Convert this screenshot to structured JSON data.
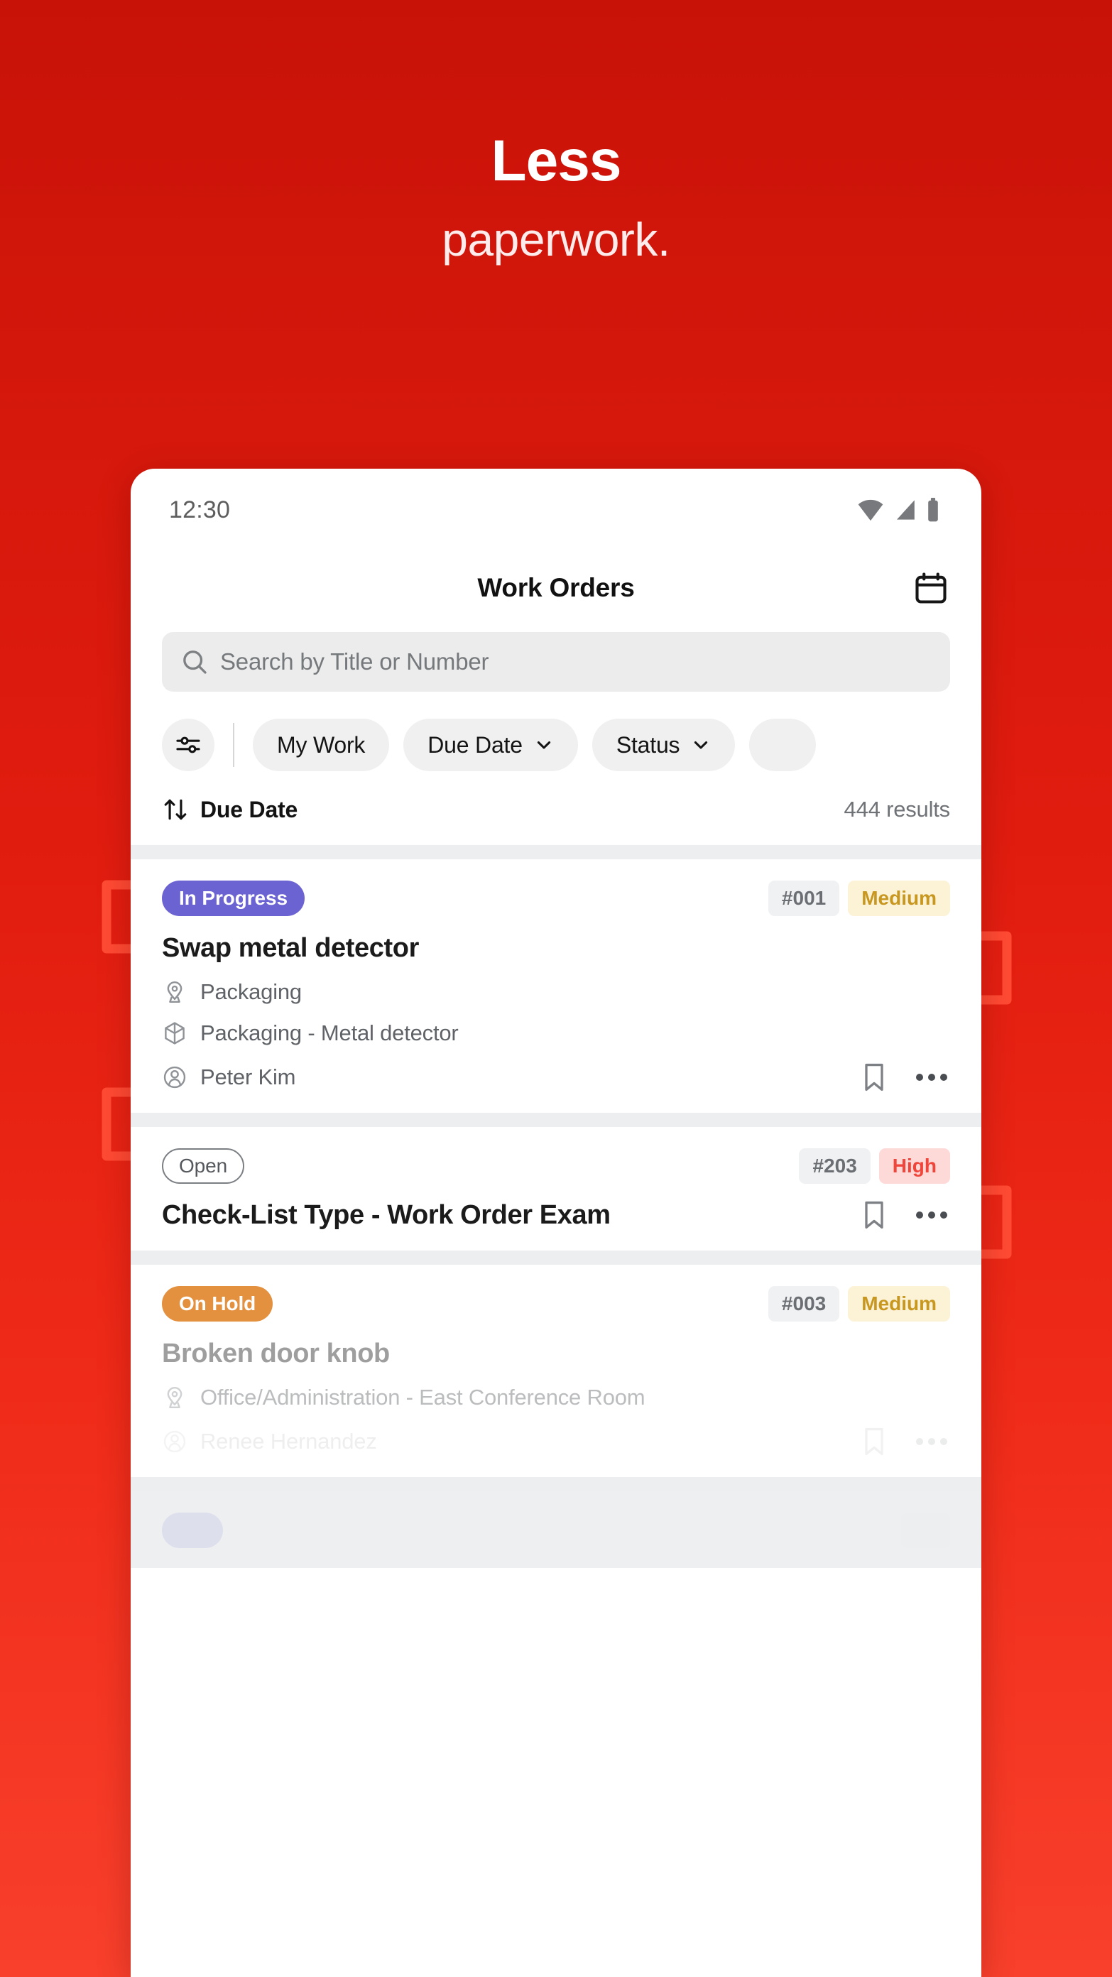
{
  "promo": {
    "headline": "Less",
    "subhead": "paperwork.",
    "background_start": "#c81208",
    "background_end": "#f8402c"
  },
  "statusbar": {
    "time": "12:30",
    "icons": [
      "wifi-icon",
      "cellular-signal-icon",
      "battery-icon"
    ]
  },
  "appbar": {
    "title": "Work Orders",
    "action_icon": "calendar-icon"
  },
  "search": {
    "placeholder": "Search by Title or Number",
    "icon": "search-icon"
  },
  "filters": {
    "tune_icon": "filter-sliders-icon",
    "chips": [
      {
        "label": "My Work",
        "has_chevron": false
      },
      {
        "label": "Due Date",
        "has_chevron": true
      },
      {
        "label": "Status",
        "has_chevron": true
      },
      {
        "label": "",
        "has_chevron": false
      }
    ]
  },
  "sort": {
    "icon": "sort-arrows-icon",
    "label": "Due Date",
    "results": "444 results"
  },
  "work_orders": [
    {
      "status": "In Progress",
      "status_bg": "#6c63d2",
      "status_style": "solid",
      "number": "#001",
      "priority": "Medium",
      "priority_bg": "#fcf2d6",
      "priority_color": "#c8971f",
      "title": "Swap metal detector",
      "location": "Packaging",
      "asset": "Packaging - Metal detector",
      "assignee": "Peter Kim",
      "bookmark_icon": "bookmark-icon",
      "more_icon": "more-horizontal-icon"
    },
    {
      "status": "Open",
      "status_bg": "transparent",
      "status_style": "outline",
      "number": "#203",
      "priority": "High",
      "priority_bg": "#fdd9d7",
      "priority_color": "#f0453a",
      "title": "Check-List Type - Work Order Exam",
      "location": "",
      "asset": "",
      "assignee": "",
      "bookmark_icon": "bookmark-icon",
      "more_icon": "more-horizontal-icon"
    },
    {
      "status": "On Hold",
      "status_bg": "#e3903f",
      "status_style": "solid",
      "number": "#003",
      "priority": "Medium",
      "priority_bg": "#fcf2d6",
      "priority_color": "#c8971f",
      "title": "Broken door knob",
      "location": "Office/Administration - East Conference Room",
      "asset": "",
      "assignee": "Renee Hernandez",
      "bookmark_icon": "bookmark-icon",
      "more_icon": "more-horizontal-icon"
    }
  ]
}
